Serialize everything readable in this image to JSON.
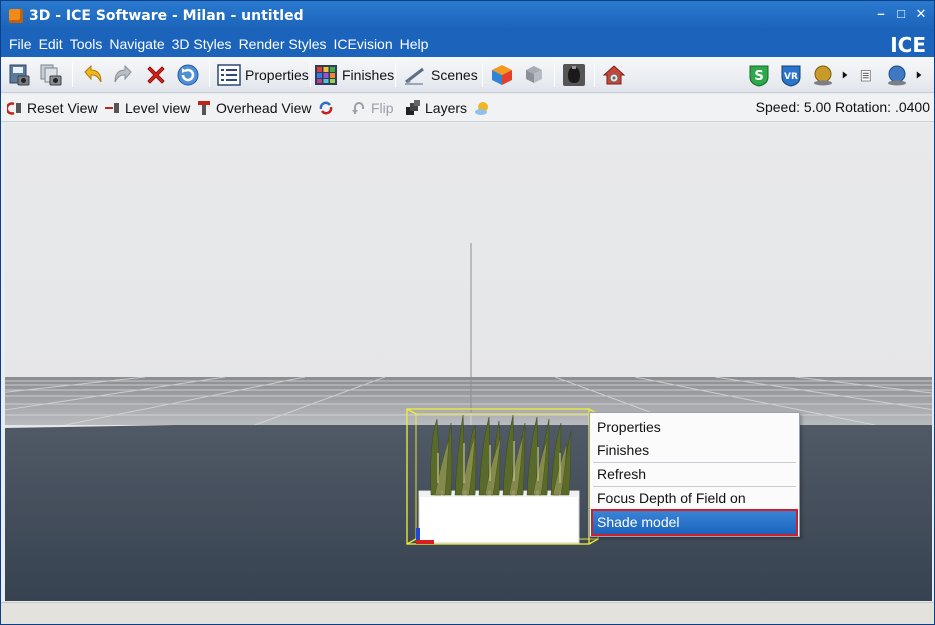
{
  "window": {
    "title": "3D - ICE Software - Milan - untitled",
    "brand": "ICE",
    "controls": [
      "–",
      "□",
      "✕"
    ]
  },
  "menu": [
    "File",
    "Edit",
    "Tools",
    "Navigate",
    "3D Styles",
    "Render Styles",
    "ICEvision",
    "Help"
  ],
  "toolbar": {
    "properties_label": "Properties",
    "finishes_label": "Finishes",
    "scenes_label": "Scenes"
  },
  "toolbar2": {
    "reset_view": "Reset View",
    "level_view": "Level view",
    "overhead_view": "Overhead View",
    "flip": "Flip",
    "layers": "Layers",
    "speed_rotation": "Speed: 5.00 Rotation: .0400"
  },
  "context_menu": {
    "items": [
      "Properties",
      "Finishes",
      "Refresh",
      "Focus Depth of Field on selected",
      "Shade model"
    ],
    "selected": "Shade model"
  },
  "colors": {
    "title_blue": "#1c64bb",
    "selection_blue": "#1b64bd",
    "highlight_red": "#d21d2a",
    "selection_box_yellow": "#f2ee3a"
  }
}
